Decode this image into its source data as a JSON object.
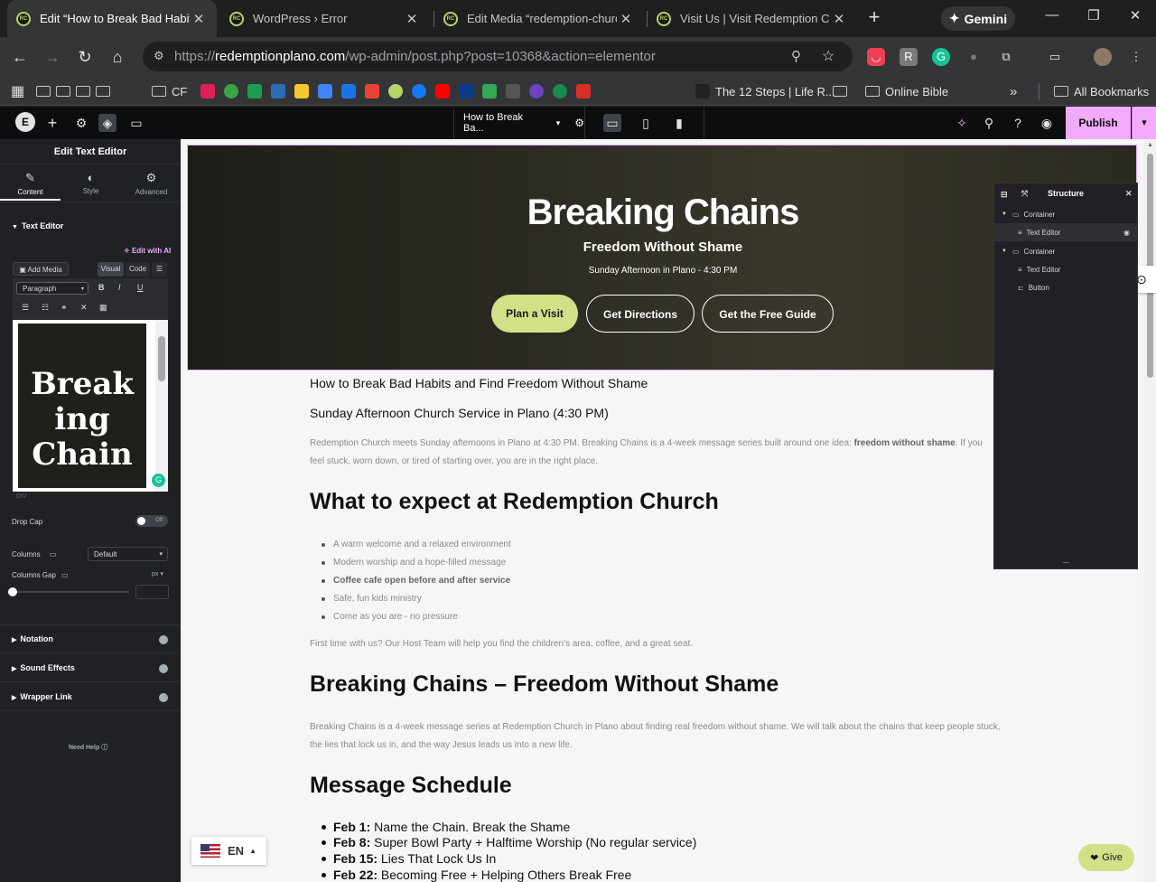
{
  "browser": {
    "tabs": [
      {
        "title": "Edit “How to Break Bad Habits"
      },
      {
        "title": "WordPress › Error"
      },
      {
        "title": "Edit Media “redemption-church"
      },
      {
        "title": "Visit Us | Visit Redemption Chu"
      }
    ],
    "gemini_label": "Gemini",
    "url_scheme": "https://",
    "url_host": "redemptionplano.com",
    "url_path": "/wp-admin/post.php?post=10368&action=elementor",
    "bookmarks": {
      "cf": "CF",
      "twelve_steps": "The 12 Steps | Life R...",
      "online_bible": "Online Bible",
      "all_bookmarks": "All Bookmarks"
    }
  },
  "elementor": {
    "page_selector": "How to Break Ba...",
    "publish_label": "Publish",
    "panel": {
      "title": "Edit Text Editor",
      "tabs": [
        "Content",
        "Style",
        "Advanced"
      ],
      "section_text_editor": "Text Editor",
      "edit_with_ai": "Edit with AI",
      "add_media": "Add Media",
      "visual_tab": "Visual",
      "code_tab": "Code",
      "format_select": "Paragraph",
      "preview_text": "Break ing Chain",
      "path_label": "DIV",
      "drop_cap": "Drop Cap",
      "drop_cap_toggle": "Off",
      "columns": "Columns",
      "columns_value": "Default",
      "columns_gap": "Columns Gap",
      "columns_gap_unit": "px",
      "sections": [
        "Notation",
        "Sound Effects",
        "Wrapper Link"
      ],
      "need_help": "Need Help"
    },
    "structure": {
      "title": "Structure",
      "items": [
        {
          "label": "Container"
        },
        {
          "label": "Text Editor"
        },
        {
          "label": "Container"
        },
        {
          "label": "Text Editor"
        },
        {
          "label": "Button"
        }
      ]
    }
  },
  "page": {
    "hero": {
      "title": "Breaking Chains",
      "subtitle": "Freedom Without Shame",
      "time": "Sunday Afternoon in Plano - 4:30 PM",
      "buttons": [
        "Plan a Visit",
        "Get Directions",
        "Get the Free Guide"
      ]
    },
    "content": {
      "heading1": "How to Break Bad Habits and Find Freedom Without Shame",
      "heading2": "Sunday Afternoon Church Service in Plano (4:30 PM)",
      "intro_a": "Redemption Church meets Sunday afternoons in Plano at 4:30 PM. Breaking Chains is a 4-week message series built around one idea: ",
      "intro_b": "freedom without shame",
      "intro_c": ". If you feel stuck, worn down, or tired of starting over, you are in the right place.",
      "expect_heading": "What to expect at Redemption Church",
      "expect_items": [
        "A warm welcome and a relaxed environment",
        "Modern worship and a hope-filled message",
        "Coffee cafe open before and after service",
        "Safe, fun kids ministry",
        "Come as you are - no pressure"
      ],
      "first_time": "First time with us? Our Host Team will help you find the children’s area, coffee, and a great seat.",
      "series_heading": "Breaking Chains – Freedom Without Shame",
      "series_text": "Breaking Chains is a 4-week message series at Redemption Church in Plano about finding real freedom without shame. We will talk about the chains that keep people stuck, the lies that lock us in, and the way Jesus leads us into a new life.",
      "schedule_heading": "Message Schedule",
      "schedule": [
        {
          "date": "Feb 1:",
          "title": "Name the Chain. Break the Shame"
        },
        {
          "date": "Feb 8:",
          "title": "Super Bowl Party + Halftime Worship (No regular service)"
        },
        {
          "date": "Feb 15:",
          "title": "Lies That Lock Us In"
        },
        {
          "date": "Feb 22:",
          "title": "Becoming Free + Helping Others Break Free"
        }
      ]
    },
    "language": "EN",
    "give_label": "Give"
  }
}
